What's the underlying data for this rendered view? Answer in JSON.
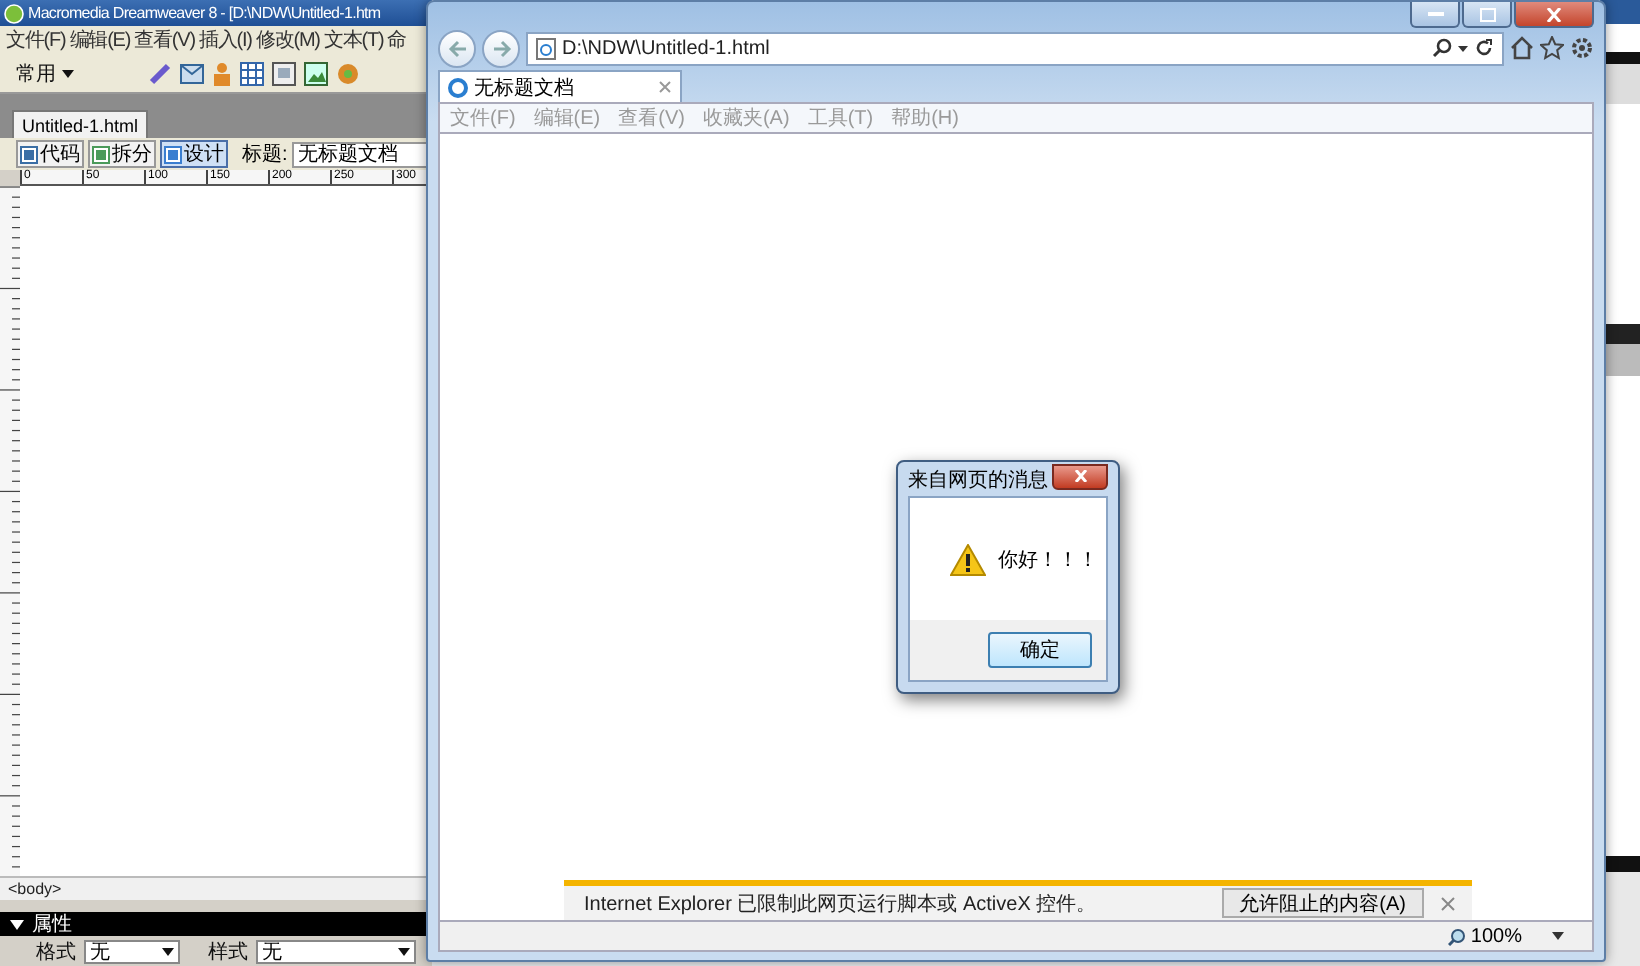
{
  "dreamweaver": {
    "title": "Macromedia Dreamweaver 8 - [D:\\NDW\\Untitled-1.htm",
    "menu": [
      "文件(F)",
      "编辑(E)",
      "查看(V)",
      "插入(I)",
      "修改(M)",
      "文本(T)",
      "命"
    ],
    "insert_category": "常用",
    "document_tab": "Untitled-1.html",
    "view_buttons": [
      {
        "label": "代码",
        "selected": false
      },
      {
        "label": "拆分",
        "selected": false
      },
      {
        "label": "设计",
        "selected": true
      }
    ],
    "title_label": "标题:",
    "title_value": "无标题文档",
    "ruler_marks": [
      "0",
      "50",
      "100",
      "150",
      "200",
      "250",
      "300"
    ],
    "tag_selector": "<body>",
    "properties": {
      "header": "属性",
      "format_label": "格式",
      "format_value": "无",
      "style_label": "样式",
      "style_value": "无"
    }
  },
  "browser": {
    "address": "D:\\NDW\\Untitled-1.html",
    "tab": "无标题文档",
    "menu": [
      "文件(F)",
      "编辑(E)",
      "查看(V)",
      "收藏夹(A)",
      "工具(T)",
      "帮助(H)"
    ],
    "info_bar": {
      "message": "Internet Explorer 已限制此网页运行脚本或 ActiveX 控件。",
      "button": "允许阻止的内容(A)"
    },
    "zoom": "100%"
  },
  "dialog": {
    "title": "来自网页的消息",
    "message": "你好！！！",
    "button": "确定"
  }
}
